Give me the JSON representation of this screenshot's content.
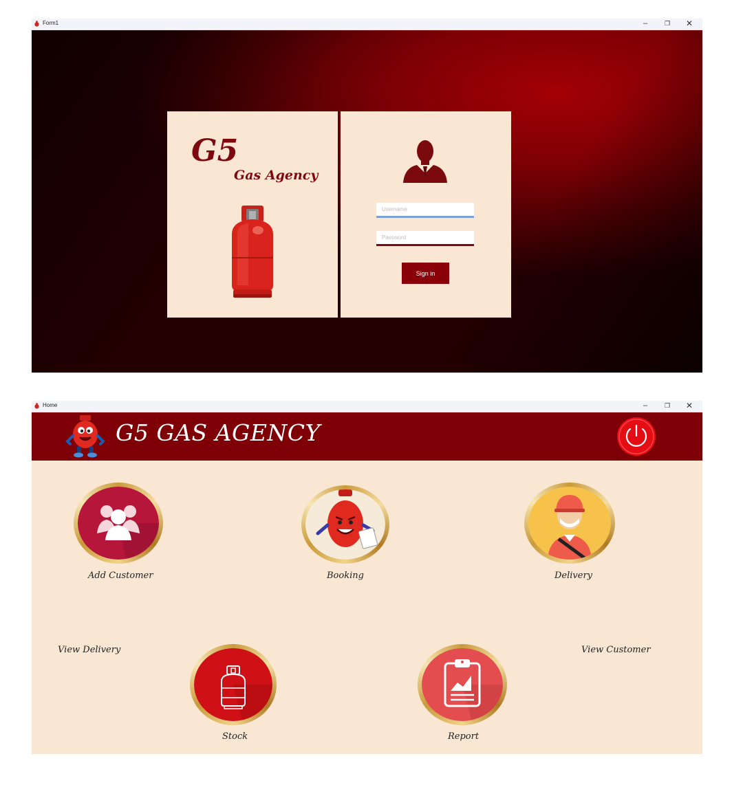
{
  "login_window": {
    "title": "Form1",
    "controls": {
      "minimize": "–",
      "maximize": "❐",
      "close": "✕"
    },
    "brand": {
      "logo": "G5",
      "subtitle": "Gas Agency"
    },
    "form": {
      "username_placeholder": "Username",
      "password_placeholder": "Password",
      "signin_label": "Sign in"
    }
  },
  "home_window": {
    "title": "Home",
    "controls": {
      "minimize": "–",
      "maximize": "❐",
      "close": "✕"
    },
    "header": {
      "title": "G5 GAS AGENCY"
    },
    "tiles": {
      "add_customer": "Add Customer",
      "booking": "Booking",
      "delivery": "Delivery",
      "view_delivery": "View Delivery",
      "stock": "Stock",
      "report": "Report",
      "view_customer": "View Customer"
    }
  },
  "colors": {
    "brand_red": "#7e0006",
    "panel_cream": "#f9e7d3",
    "accent_red": "#e50d14",
    "gold": "#c99a3a"
  },
  "icons": [
    "app-icon",
    "cylinder-icon",
    "user-silhouette-icon",
    "mascot-icon",
    "power-icon",
    "group-icon",
    "booking-mascot-icon",
    "delivery-person-icon",
    "stock-cylinder-icon",
    "report-clipboard-icon"
  ]
}
